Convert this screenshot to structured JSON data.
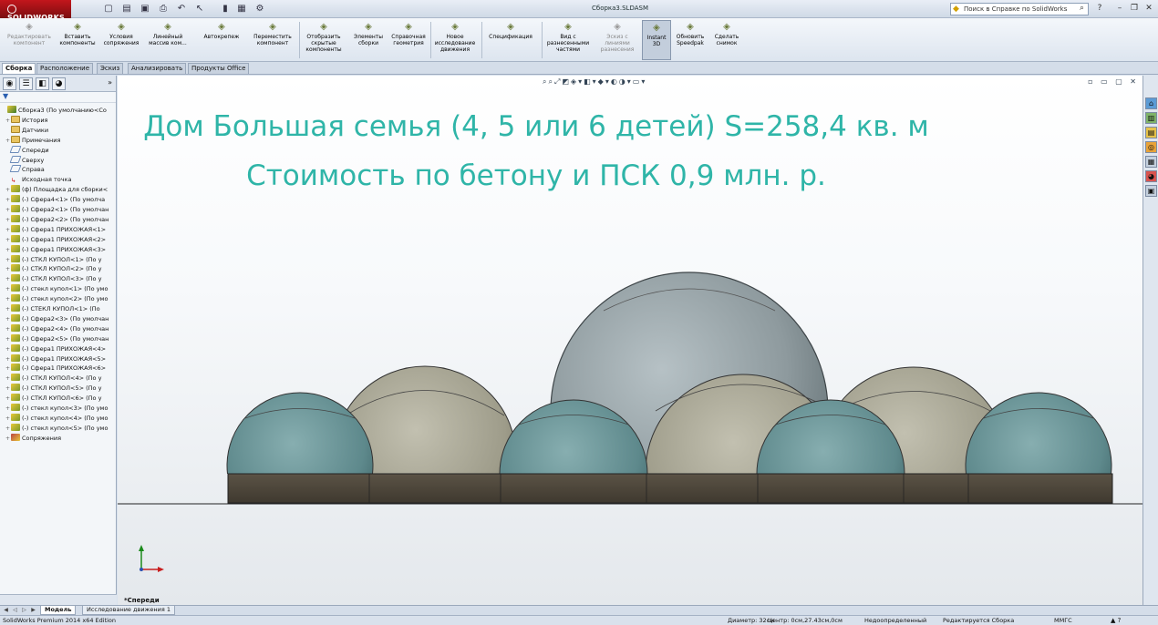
{
  "app": {
    "brand": "SOLIDWORKS",
    "document_title": "Сборка3.SLDASM",
    "help_search_placeholder": "Поиск в Справке по SolidWorks"
  },
  "commands": [
    {
      "label": "Редактировать компонент",
      "icon": "edit-component-icon",
      "disabled": true
    },
    {
      "label": "Вставить компоненты",
      "icon": "insert-components-icon"
    },
    {
      "label": "Условия сопряжения",
      "icon": "mate-icon"
    },
    {
      "label": "Линейный массив ком...",
      "icon": "linear-pattern-icon"
    },
    {
      "label": "Автокрепеж",
      "icon": "smart-fasteners-icon"
    },
    {
      "label": "Переместить компонент",
      "icon": "move-component-icon"
    },
    {
      "label": "Отобразить скрытые компоненты",
      "icon": "show-hidden-icon"
    },
    {
      "label": "Элементы сборки",
      "icon": "assembly-features-icon"
    },
    {
      "label": "Справочная геометрия",
      "icon": "reference-geometry-icon"
    },
    {
      "label": "Новое исследование движения",
      "icon": "new-motion-study-icon"
    },
    {
      "label": "Спецификация",
      "icon": "bom-icon"
    },
    {
      "label": "Вид с разнесенными частями",
      "icon": "exploded-view-icon"
    },
    {
      "label": "Эскиз с линиями разнесения",
      "icon": "explode-line-sketch-icon",
      "disabled": true
    },
    {
      "label": "Instant 3D",
      "icon": "instant3d-icon",
      "active": true
    },
    {
      "label": "Обновить Speedpak",
      "icon": "speedpak-icon"
    },
    {
      "label": "Сделать снимок",
      "icon": "snapshot-icon"
    }
  ],
  "tabs": [
    "Сборка",
    "Расположение",
    "Эскиз",
    "Анализировать",
    "Продукты Office"
  ],
  "tree": [
    {
      "label": "Сборка3  (По умолчанию<Со",
      "icon": "asm",
      "expand": ""
    },
    {
      "label": "История",
      "icon": "fold",
      "expand": "+"
    },
    {
      "label": "Датчики",
      "icon": "fold",
      "expand": ""
    },
    {
      "label": "Примечания",
      "icon": "fold",
      "expand": "+"
    },
    {
      "label": "Спереди",
      "icon": "plane",
      "expand": ""
    },
    {
      "label": "Сверху",
      "icon": "plane",
      "expand": ""
    },
    {
      "label": "Справа",
      "icon": "plane",
      "expand": ""
    },
    {
      "label": "Исходная точка",
      "icon": "org",
      "expand": ""
    },
    {
      "label": "(ф) Площадка для сборки<",
      "icon": "part",
      "expand": "+"
    },
    {
      "label": "(-) Сфера4<1> (По умолча",
      "icon": "part",
      "expand": "+"
    },
    {
      "label": "(-) Сфера2<1> (По умолчан",
      "icon": "part",
      "expand": "+"
    },
    {
      "label": "(-) Сфера2<2> (По умолчан",
      "icon": "part",
      "expand": "+"
    },
    {
      "label": "(-) Сфера1 ПРИХОЖАЯ<1>",
      "icon": "part",
      "expand": "+"
    },
    {
      "label": "(-) Сфера1 ПРИХОЖАЯ<2>",
      "icon": "part",
      "expand": "+"
    },
    {
      "label": "(-) Сфера1 ПРИХОЖАЯ<3>",
      "icon": "part",
      "expand": "+"
    },
    {
      "label": "(-) СТКЛ КУПОЛ<1> (По у",
      "icon": "part",
      "expand": "+"
    },
    {
      "label": "(-) СТКЛ КУПОЛ<2> (По у",
      "icon": "part",
      "expand": "+"
    },
    {
      "label": "(-) СТКЛ КУПОЛ<3> (По у",
      "icon": "part",
      "expand": "+"
    },
    {
      "label": "(-) стекл купол<1> (По умо",
      "icon": "part",
      "expand": "+"
    },
    {
      "label": "(-) стекл купол<2> (По умо",
      "icon": "part",
      "expand": "+"
    },
    {
      "label": "(-) СТЕКЛ КУПОЛ<1> (По",
      "icon": "part",
      "expand": "+"
    },
    {
      "label": "(-) Сфера2<3> (По умолчан",
      "icon": "part",
      "expand": "+"
    },
    {
      "label": "(-) Сфера2<4> (По умолчан",
      "icon": "part",
      "expand": "+"
    },
    {
      "label": "(-) Сфера2<5> (По умолчан",
      "icon": "part",
      "expand": "+"
    },
    {
      "label": "(-) Сфера1 ПРИХОЖАЯ<4>",
      "icon": "part",
      "expand": "+"
    },
    {
      "label": "(-) Сфера1 ПРИХОЖАЯ<5>",
      "icon": "part",
      "expand": "+"
    },
    {
      "label": "(-) Сфера1 ПРИХОЖАЯ<6>",
      "icon": "part",
      "expand": "+"
    },
    {
      "label": "(-) СТКЛ КУПОЛ<4> (По у",
      "icon": "part",
      "expand": "+"
    },
    {
      "label": "(-) СТКЛ КУПОЛ<5> (По у",
      "icon": "part",
      "expand": "+"
    },
    {
      "label": "(-) СТКЛ КУПОЛ<6> (По у",
      "icon": "part",
      "expand": "+"
    },
    {
      "label": "(-) стекл купол<3> (По умо",
      "icon": "part",
      "expand": "+"
    },
    {
      "label": "(-) стекл купол<4> (По умо",
      "icon": "part",
      "expand": "+"
    },
    {
      "label": "(-) стекл купол<5> (По умо",
      "icon": "part",
      "expand": "+"
    },
    {
      "label": "Сопряжения",
      "icon": "mate",
      "expand": "+"
    }
  ],
  "viewport": {
    "caption_line1": "Дом Большая семья (4, 5 или 6 детей) S=258,4 кв. м",
    "caption_line2": "Стоимость по бетону и ПСК 0,9 млн. р.",
    "view_name": "*Спереди",
    "caption_color": "#2fb5a8"
  },
  "bottom_tabs": [
    "Модель",
    "Исследование движения 1"
  ],
  "status": {
    "product": "SolidWorks Premium 2014 x64 Edition",
    "diameter": "Диаметр: 32см",
    "center": "Центр: 0см,27.43см,0см",
    "definition": "Недоопределенный",
    "editing": "Редактируется Сборка",
    "units": "ММГС"
  }
}
